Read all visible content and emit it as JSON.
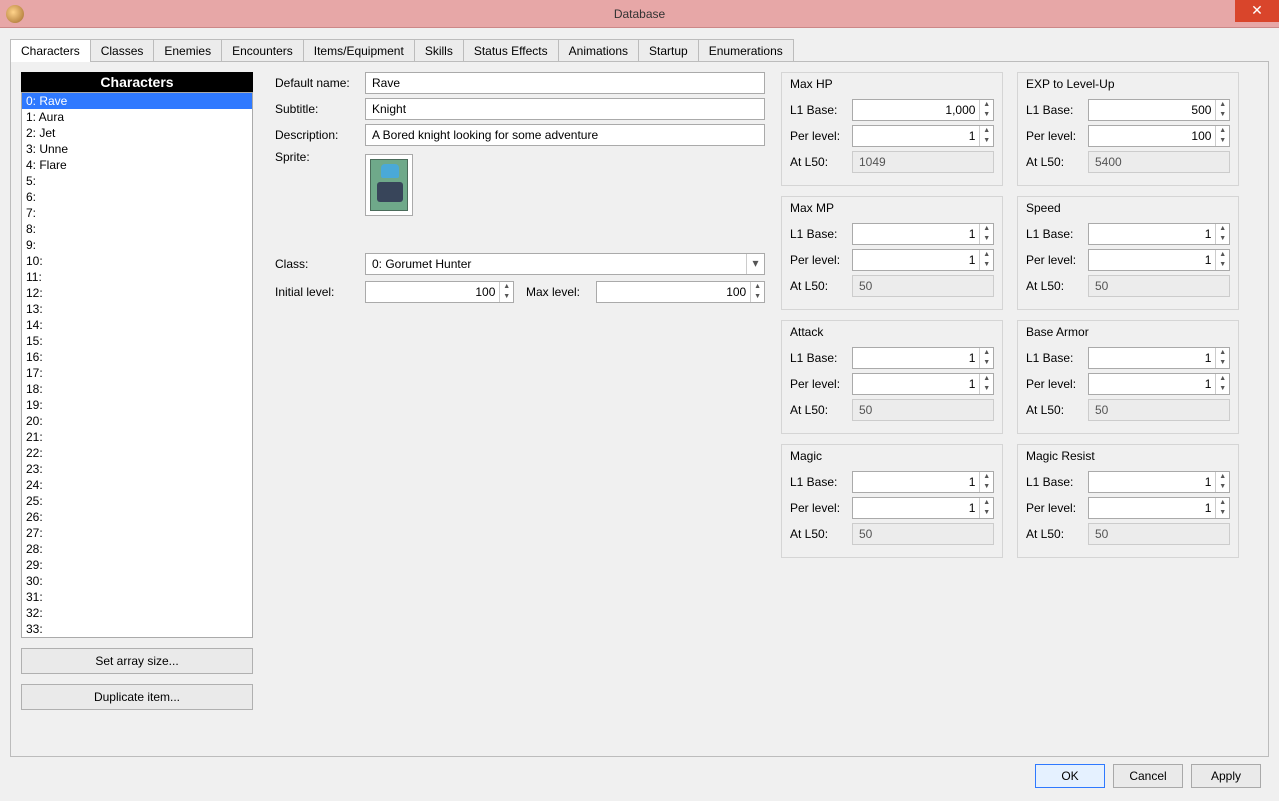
{
  "window": {
    "title": "Database"
  },
  "tabs": [
    "Characters",
    "Classes",
    "Enemies",
    "Encounters",
    "Items/Equipment",
    "Skills",
    "Status Effects",
    "Animations",
    "Startup",
    "Enumerations"
  ],
  "activeTab": 0,
  "listHeader": "Characters",
  "characters": [
    "0: Rave",
    "1: Aura",
    "2: Jet",
    "3: Unne",
    "4: Flare",
    "5:",
    "6:",
    "7:",
    "8:",
    "9:",
    "10:",
    "11:",
    "12:",
    "13:",
    "14:",
    "15:",
    "16:",
    "17:",
    "18:",
    "19:",
    "20:",
    "21:",
    "22:",
    "23:",
    "24:",
    "25:",
    "26:",
    "27:",
    "28:",
    "29:",
    "30:",
    "31:",
    "32:",
    "33:"
  ],
  "selectedCharacter": 0,
  "buttons": {
    "setArraySize": "Set array size...",
    "duplicate": "Duplicate item...",
    "ok": "OK",
    "cancel": "Cancel",
    "apply": "Apply"
  },
  "fields": {
    "defaultName": {
      "label": "Default name:",
      "value": "Rave"
    },
    "subtitle": {
      "label": "Subtitle:",
      "value": "Knight"
    },
    "description": {
      "label": "Description:",
      "value": "A Bored knight looking for some adventure"
    },
    "sprite": {
      "label": "Sprite:"
    },
    "class": {
      "label": "Class:",
      "value": "0: Gorumet Hunter"
    },
    "initialLevel": {
      "label": "Initial level:",
      "value": "100"
    },
    "maxLevel": {
      "label": "Max level:",
      "value": "100"
    }
  },
  "statLabels": {
    "l1base": "L1 Base:",
    "perLevel": "Per level:",
    "atL50": "At L50:"
  },
  "stats": [
    {
      "title": "Max HP",
      "l1base": "1,000",
      "perLevel": "1",
      "atL50": "1049"
    },
    {
      "title": "EXP to Level-Up",
      "l1base": "500",
      "perLevel": "100",
      "atL50": "5400"
    },
    {
      "title": "Max MP",
      "l1base": "1",
      "perLevel": "1",
      "atL50": "50"
    },
    {
      "title": "Speed",
      "l1base": "1",
      "perLevel": "1",
      "atL50": "50"
    },
    {
      "title": "Attack",
      "l1base": "1",
      "perLevel": "1",
      "atL50": "50"
    },
    {
      "title": "Base Armor",
      "l1base": "1",
      "perLevel": "1",
      "atL50": "50"
    },
    {
      "title": "Magic",
      "l1base": "1",
      "perLevel": "1",
      "atL50": "50"
    },
    {
      "title": "Magic Resist",
      "l1base": "1",
      "perLevel": "1",
      "atL50": "50"
    }
  ]
}
